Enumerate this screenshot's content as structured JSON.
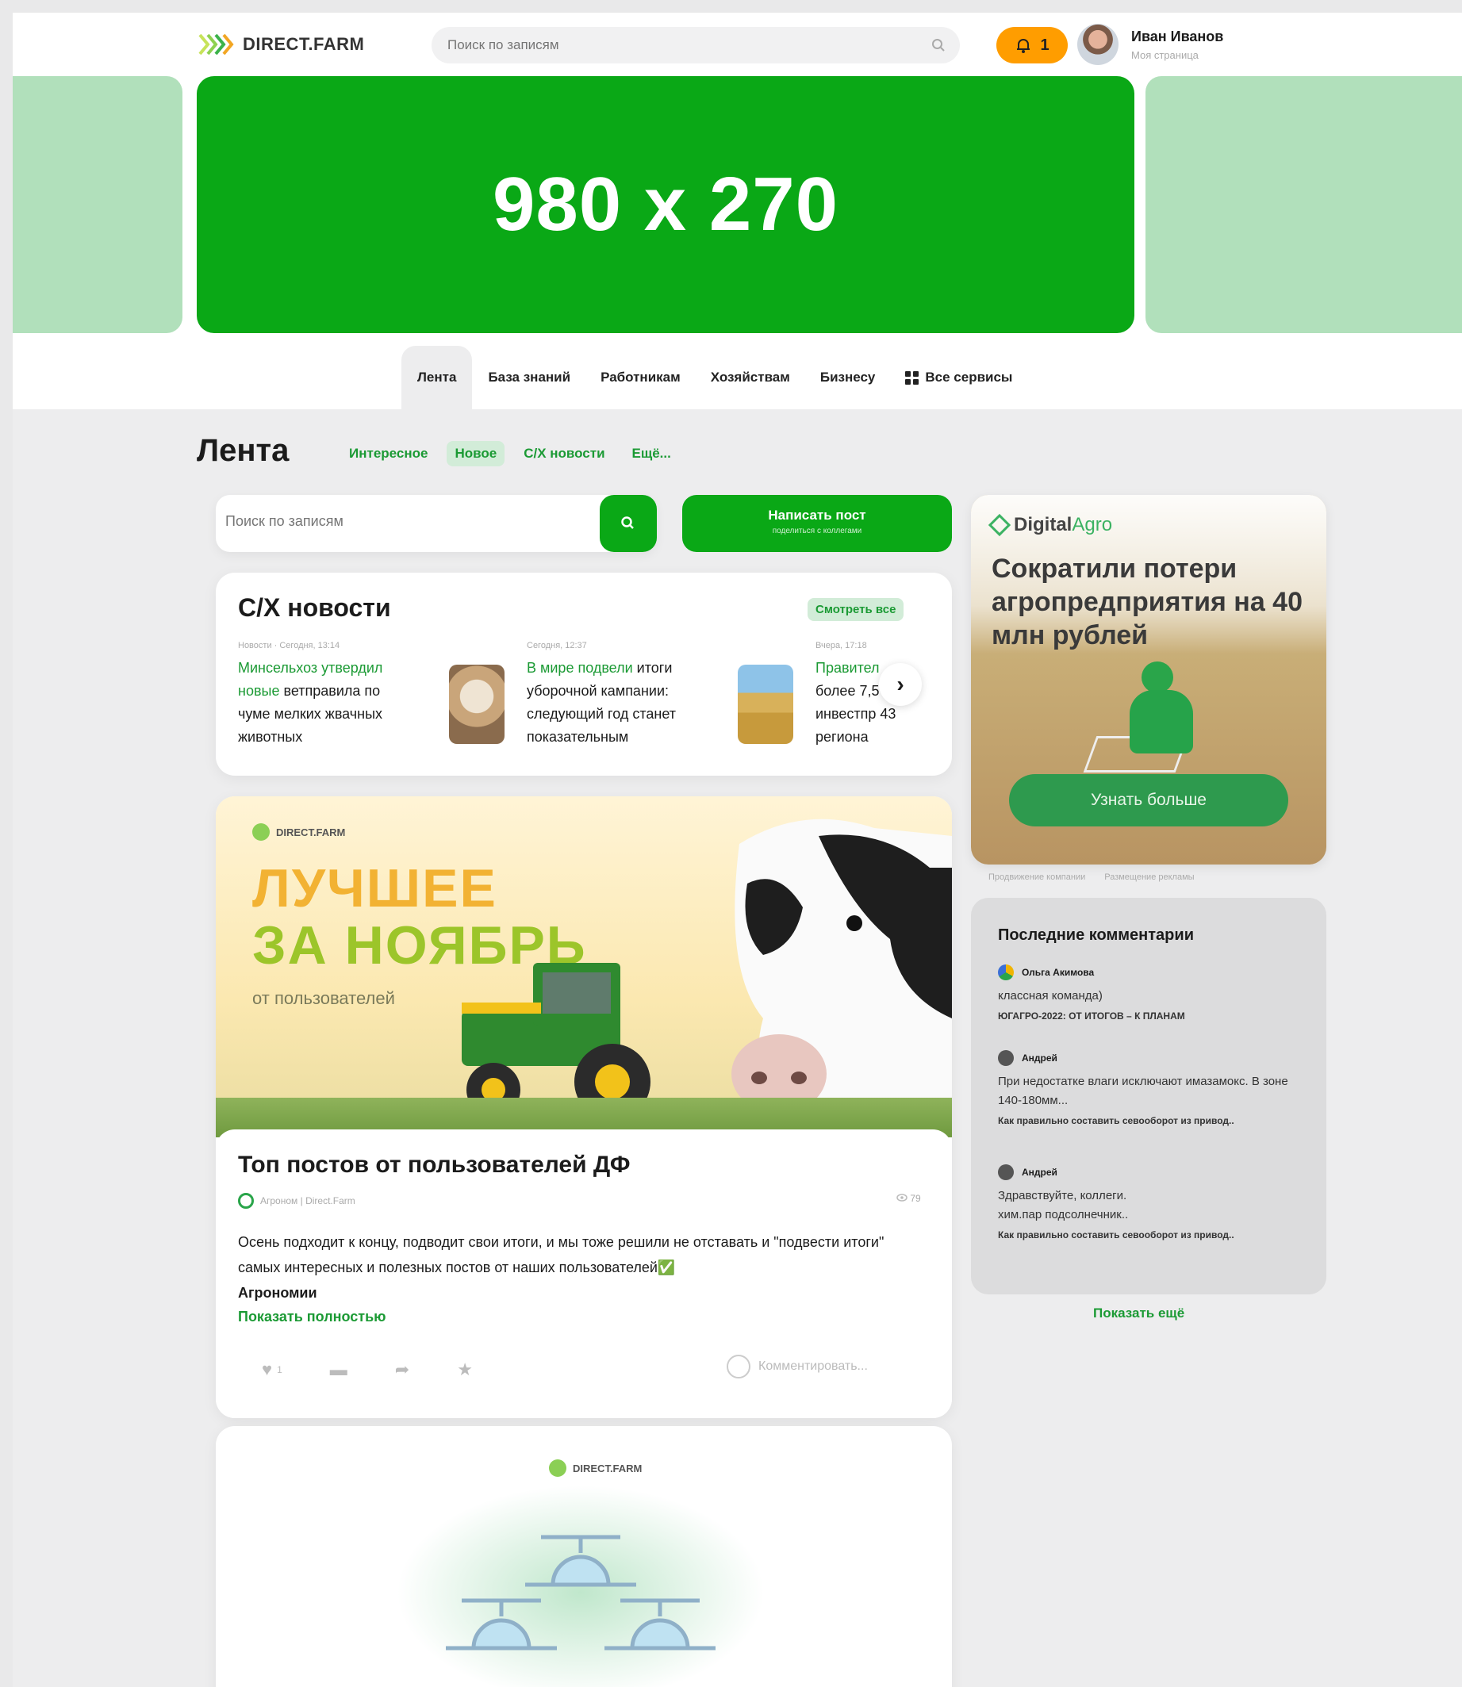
{
  "header": {
    "logo": "DIRECT.FARM",
    "search_placeholder": "Поиск по записям",
    "notifications_count": "1",
    "user_name": "Иван Иванов",
    "user_sub": "Моя страница"
  },
  "banner": {
    "text": "980 x 270"
  },
  "nav": {
    "items": [
      "Лента",
      "База знаний",
      "Работникам",
      "Хозяйствам",
      "Бизнесу",
      "Все сервисы"
    ]
  },
  "feed": {
    "title": "Лента",
    "tabs": [
      "Интересное",
      "Новое",
      "С/Х новости",
      "Ещё..."
    ],
    "search_placeholder": "Поиск по записям",
    "write_post": "Написать пост",
    "write_post_sub": "поделиться с коллегами"
  },
  "news": {
    "title": "С/Х новости",
    "see_all": "Смотреть все",
    "items": [
      {
        "meta": "Новости · Сегодня, 13:14",
        "highlight": "Минсельхоз утвердил новые",
        "rest": " ветправила по чуме мелких жвачных животных"
      },
      {
        "meta": "Сегодня, 12:37",
        "highlight": "В мире подвели",
        "rest": " итоги уборочной кампании: следующий год станет показательным"
      },
      {
        "meta": "Вчера, 17:18",
        "highlight": "Правител",
        "rest": " более 7,5 инвестпр 43 региона"
      }
    ]
  },
  "post": {
    "brand": "DIRECT.FARM",
    "big1": "ЛУЧШЕЕ",
    "big2": "ЗА НОЯБРЬ",
    "from_users": "от пользователей",
    "title": "Топ постов от пользователей ДФ",
    "author": "Агроном | Direct.Farm",
    "views": "79",
    "text": "Осень подходит к концу, подводит свои итоги, и мы тоже решили не отставать и \"подвести итоги\" самых интересных и полезных постов от наших пользователей✅",
    "text_bold": "Агрономии",
    "show_full": "Показать полностью",
    "likes": "1",
    "comment_placeholder": "Комментировать..."
  },
  "post2": {
    "brand": "DIRECT.FARM"
  },
  "ad": {
    "brand_a": "Digital",
    "brand_b": "Agro",
    "headline": "Сократили потери агропредприятия на 40 млн рублей",
    "button": "Узнать больше",
    "links": [
      "Продвижение компании",
      "Размещение рекламы"
    ]
  },
  "comments": {
    "title": "Последние комментарии",
    "items": [
      {
        "user": "Ольга Акимова",
        "text": "классная команда)",
        "link": "ЮГАГРО-2022: ОТ ИТОГОВ – К ПЛАНАМ"
      },
      {
        "user": "Андрей",
        "text": "При недостатке влаги исключают имазамокс. В зоне 140-180мм...",
        "link": "Как правильно составить севооборот из привод.."
      },
      {
        "user": "Андрей",
        "text": "Здравствуйте, коллеги. хим.пар подсолнечник..",
        "link": "Как правильно составить севооборот из привод.."
      }
    ],
    "show_more": "Показать ещё"
  },
  "colors": {
    "brand_green": "#0aa816",
    "accent_orange": "#ff9d00",
    "link_green": "#1b9a34"
  }
}
